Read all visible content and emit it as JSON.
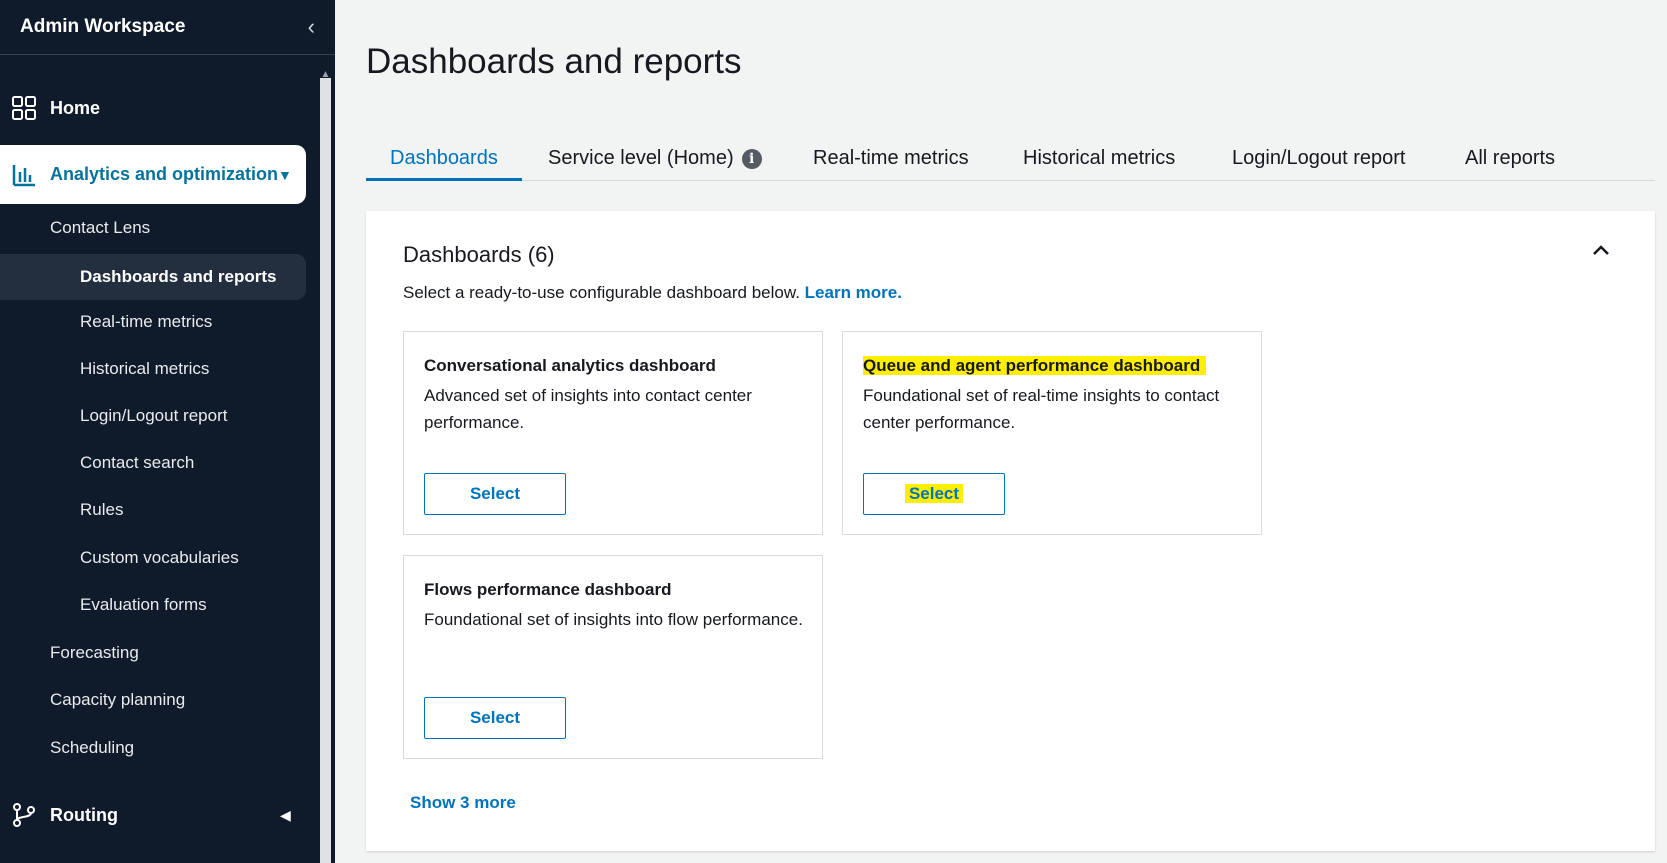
{
  "sidebar": {
    "title": "Admin Workspace",
    "home_label": "Home",
    "analytics_label": "Analytics and optimization",
    "sub_items": {
      "contact_lens": "Contact Lens",
      "dashboards_reports": "Dashboards and reports",
      "realtime": "Real-time metrics",
      "historical": "Historical metrics",
      "login_logout": "Login/Logout report",
      "contact_search": "Contact search",
      "rules": "Rules",
      "custom_vocab": "Custom vocabularies",
      "evaluation_forms": "Evaluation forms",
      "forecasting": "Forecasting",
      "capacity_planning": "Capacity planning",
      "scheduling": "Scheduling"
    },
    "routing_label": "Routing"
  },
  "main": {
    "page_title": "Dashboards and reports",
    "tabs": [
      {
        "label": "Dashboards"
      },
      {
        "label": "Service level (Home)"
      },
      {
        "label": "Real-time metrics"
      },
      {
        "label": "Historical metrics"
      },
      {
        "label": "Login/Logout report"
      },
      {
        "label": "All reports"
      }
    ],
    "panel": {
      "title": "Dashboards (6)",
      "description": "Select a ready-to-use configurable dashboard below.",
      "learn_more": "Learn more.",
      "cards": [
        {
          "title": "Conversational analytics dashboard",
          "description": "Advanced set of insights into contact center performance.",
          "button": "Select"
        },
        {
          "title": "Queue and agent performance dashboard",
          "description": "Foundational set of real-time insights to contact center performance.",
          "button": "Select"
        },
        {
          "title": "Flows performance dashboard",
          "description": "Foundational set of insights into flow performance.",
          "button": "Select"
        }
      ],
      "show_more": "Show 3 more"
    }
  },
  "colors": {
    "sidebar_bg": "#0f1b2a",
    "accent": "#0073bb",
    "highlight": "#ffee00"
  },
  "icons": {
    "collapse_sidebar": "chevron-left-icon",
    "home": "grid-icon",
    "analytics": "bar-chart-icon",
    "routing": "branch-icon",
    "info": "info-icon",
    "panel_collapse": "chevron-up-icon"
  }
}
